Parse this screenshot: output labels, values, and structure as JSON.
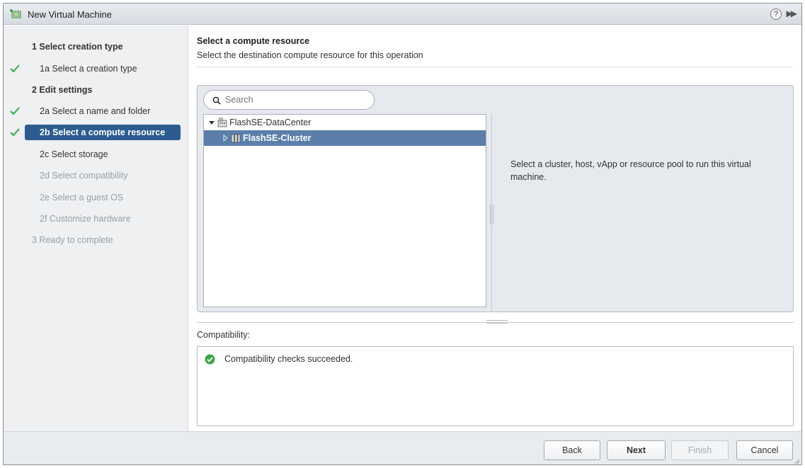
{
  "window": {
    "title": "New Virtual Machine",
    "help_label": "?",
    "expand_label": "▶▶"
  },
  "sidebar": {
    "steps": [
      {
        "label": "1  Select creation type",
        "kind": "header",
        "done": false
      },
      {
        "label": "1a  Select a creation type",
        "kind": "sub",
        "done": true
      },
      {
        "label": "2  Edit settings",
        "kind": "header",
        "done": false
      },
      {
        "label": "2a  Select a name and folder",
        "kind": "sub",
        "done": true
      },
      {
        "label": "2b  Select a compute resource",
        "kind": "sub",
        "done": true,
        "active": true
      },
      {
        "label": "2c  Select storage",
        "kind": "sub",
        "done": false
      },
      {
        "label": "2d  Select compatibility",
        "kind": "sub",
        "done": false,
        "disabled": true
      },
      {
        "label": "2e  Select a guest OS",
        "kind": "sub",
        "done": false,
        "disabled": true
      },
      {
        "label": "2f  Customize hardware",
        "kind": "sub",
        "done": false,
        "disabled": true
      },
      {
        "label": "3  Ready to complete",
        "kind": "header-plain",
        "done": false,
        "disabled": true
      }
    ]
  },
  "main": {
    "heading": "Select a compute resource",
    "subheading": "Select the destination compute resource for this operation",
    "search": {
      "placeholder": "Search",
      "value": ""
    },
    "tree": [
      {
        "label": "FlashSE-DataCenter",
        "icon": "datacenter-icon",
        "expanded": true
      },
      {
        "label": "FlashSE-Cluster",
        "icon": "cluster-icon",
        "expanded": false,
        "selected": true
      }
    ],
    "info_text": "Select a cluster, host, vApp or resource pool to run this virtual machine.",
    "compatibility": {
      "label": "Compatibility:",
      "message": "Compatibility checks succeeded.",
      "status_color": "#3aa646"
    }
  },
  "footer": {
    "back_label": "Back",
    "next_label": "Next",
    "finish_label": "Finish",
    "cancel_label": "Cancel"
  },
  "colors": {
    "active_step_bg": "#2b5b8f",
    "selected_row_bg": "#5b7faa",
    "check_green": "#3aa646"
  }
}
